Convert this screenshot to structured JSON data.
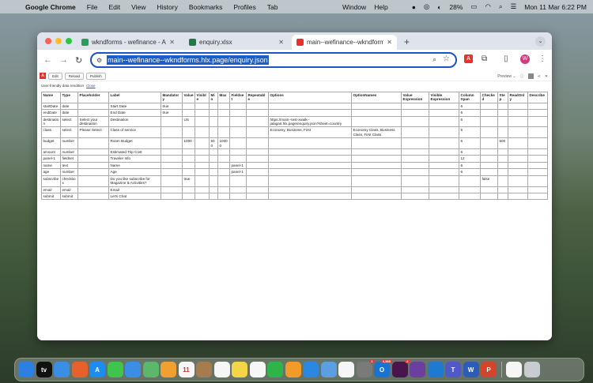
{
  "menubar": {
    "app_name": "Google Chrome",
    "items": [
      "File",
      "Edit",
      "View",
      "History",
      "Bookmarks",
      "Profiles",
      "Tab"
    ],
    "right_items": [
      "Window",
      "Help"
    ],
    "battery": "28%",
    "datetime": "Mon 11 Mar  6:22 PM"
  },
  "browser": {
    "tabs": [
      {
        "title": "wkndforms - wefinance - All",
        "favicon_color": "#2a9d5c",
        "active": false
      },
      {
        "title": "enquiry.xlsx",
        "favicon_color": "#1f7a45",
        "active": false
      },
      {
        "title": "main--wefinance--wkndforms",
        "favicon_color": "#e8312b",
        "active": true
      }
    ],
    "new_tab": "+",
    "url": "main--wefinance--wkndforms.hlx.page/enquiry.json",
    "profile_initial": "W",
    "ext_letter": "A"
  },
  "sidekick": {
    "buttons": [
      "Edit",
      "Reload",
      "Publish"
    ],
    "preview_label": "Preview",
    "rendition_text": "User-friendly data rendition",
    "close_label": "Close"
  },
  "table": {
    "headers": [
      "Name",
      "Type",
      "Placeholder",
      "Label",
      "Mandatory",
      "Value",
      "Visible",
      "Min",
      "Max",
      "Fieldset",
      "Repeatable",
      "Options",
      "OptionNames",
      "Value Expression",
      "Visible Expression",
      "Column Span",
      "Checked",
      "Step",
      "ReadOnly",
      "Describe"
    ],
    "rows": [
      [
        "startDate",
        "date",
        "",
        "Start Date",
        "true",
        "",
        "",
        "",
        "",
        "",
        "",
        "",
        "",
        "",
        "",
        "6",
        "",
        "",
        "",
        ""
      ],
      [
        "endDate",
        "date",
        "",
        "End Date",
        "true",
        "",
        "",
        "",
        "",
        "",
        "",
        "",
        "",
        "",
        "",
        "6",
        "",
        "",
        "",
        ""
      ],
      [
        "destination",
        "select",
        "Select your destination",
        "Destination",
        "",
        "US",
        "",
        "",
        "",
        "",
        "",
        "https://main--test-xwalk--jalagari.hlx.page/enquiry.json?sheet=country",
        "",
        "",
        "",
        "6",
        "",
        "",
        "",
        ""
      ],
      [
        "class",
        "select",
        "Please Select",
        "Class of service",
        "",
        "",
        "",
        "",
        "",
        "",
        "",
        "Economy, Business, First",
        "Economy Class, Business Class, First Class",
        "",
        "",
        "6",
        "",
        "",
        "",
        ""
      ],
      [
        "budget",
        "number",
        "",
        "Room Budget",
        "",
        "1000",
        "",
        "500",
        "10000",
        "",
        "",
        "",
        "",
        "",
        "",
        "6",
        "",
        "500",
        "",
        ""
      ],
      [
        "amount",
        "number",
        "",
        "Estimated Trip Cost",
        "",
        "",
        "",
        "",
        "",
        "",
        "",
        "",
        "",
        "",
        "",
        "6",
        "",
        "",
        "",
        ""
      ],
      [
        "panel-1",
        "fieldset",
        "",
        "Traveler Info",
        "",
        "",
        "",
        "",
        "",
        "",
        "",
        "",
        "",
        "",
        "",
        "12",
        "",
        "",
        "",
        ""
      ],
      [
        "name",
        "text",
        "",
        "Name",
        "",
        "",
        "",
        "",
        "",
        "panel-1",
        "",
        "",
        "",
        "",
        "",
        "6",
        "",
        "",
        "",
        ""
      ],
      [
        "age",
        "number",
        "",
        "Age",
        "",
        "",
        "",
        "",
        "",
        "panel-1",
        "",
        "",
        "",
        "",
        "",
        "6",
        "",
        "",
        "",
        ""
      ],
      [
        "subscribe",
        "checkbox",
        "",
        "Do you like subscribe for Magazine & Activities?",
        "",
        "true",
        "",
        "",
        "",
        "",
        "",
        "",
        "",
        "",
        "",
        "",
        "false",
        "",
        "",
        ""
      ],
      [
        "email",
        "email",
        "",
        "Email",
        "",
        "",
        "",
        "",
        "",
        "",
        "",
        "",
        "",
        "",
        "",
        "",
        "",
        "",
        "",
        ""
      ],
      [
        "submit",
        "submit",
        "",
        "Let's Chat",
        "",
        "",
        "",
        "",
        "",
        "",
        "",
        "",
        "",
        "",
        "",
        "",
        "",
        "",
        "",
        ""
      ]
    ]
  },
  "dock": {
    "apps": [
      {
        "name": "finder",
        "color": "#2d7fe0",
        "label": ""
      },
      {
        "name": "apple-tv",
        "color": "#111",
        "label": "tv"
      },
      {
        "name": "safari",
        "color": "#3a8ee6",
        "label": ""
      },
      {
        "name": "firefox",
        "color": "#e8612b",
        "label": ""
      },
      {
        "name": "app-store",
        "color": "#1c8cf0",
        "label": "A"
      },
      {
        "name": "messages",
        "color": "#3fc44d",
        "label": ""
      },
      {
        "name": "mail",
        "color": "#3a8ee6",
        "label": ""
      },
      {
        "name": "maps",
        "color": "#5bb86b",
        "label": ""
      },
      {
        "name": "photos",
        "color": "#f0a030",
        "label": ""
      },
      {
        "name": "calendar",
        "color": "#f6f6f6",
        "label": "11"
      },
      {
        "name": "folder",
        "color": "#a67c4e",
        "label": ""
      },
      {
        "name": "reminders",
        "color": "#f6f6f6",
        "label": ""
      },
      {
        "name": "notes",
        "color": "#f5d548",
        "label": ""
      },
      {
        "name": "freeform",
        "color": "#f6f6f6",
        "label": ""
      },
      {
        "name": "numbers",
        "color": "#2fb44a",
        "label": ""
      },
      {
        "name": "pages",
        "color": "#f29b28",
        "label": ""
      },
      {
        "name": "keynote",
        "color": "#2a88e0",
        "label": ""
      },
      {
        "name": "preview",
        "color": "#5aa0e0",
        "label": ""
      },
      {
        "name": "chrome",
        "color": "#f6f6f6",
        "label": ""
      },
      {
        "name": "system-settings",
        "color": "#7a7a7a",
        "label": ""
      },
      {
        "name": "outlook",
        "color": "#1874d0",
        "label": "O"
      },
      {
        "name": "slack",
        "color": "#4a154b",
        "label": ""
      },
      {
        "name": "github",
        "color": "#6b3fa0",
        "label": ""
      },
      {
        "name": "vscode",
        "color": "#1e7ad0",
        "label": ""
      },
      {
        "name": "teams",
        "color": "#5059c9",
        "label": "T"
      },
      {
        "name": "word",
        "color": "#2b5cb8",
        "label": "W"
      },
      {
        "name": "powerpoint",
        "color": "#d0452b",
        "label": "P"
      },
      {
        "name": "document",
        "color": "#f6f6f6",
        "label": ""
      },
      {
        "name": "trash",
        "color": "#c8ccd0",
        "label": ""
      }
    ],
    "badges": {
      "outlook": "6,565",
      "slack": "2",
      "system-settings": "1"
    }
  }
}
